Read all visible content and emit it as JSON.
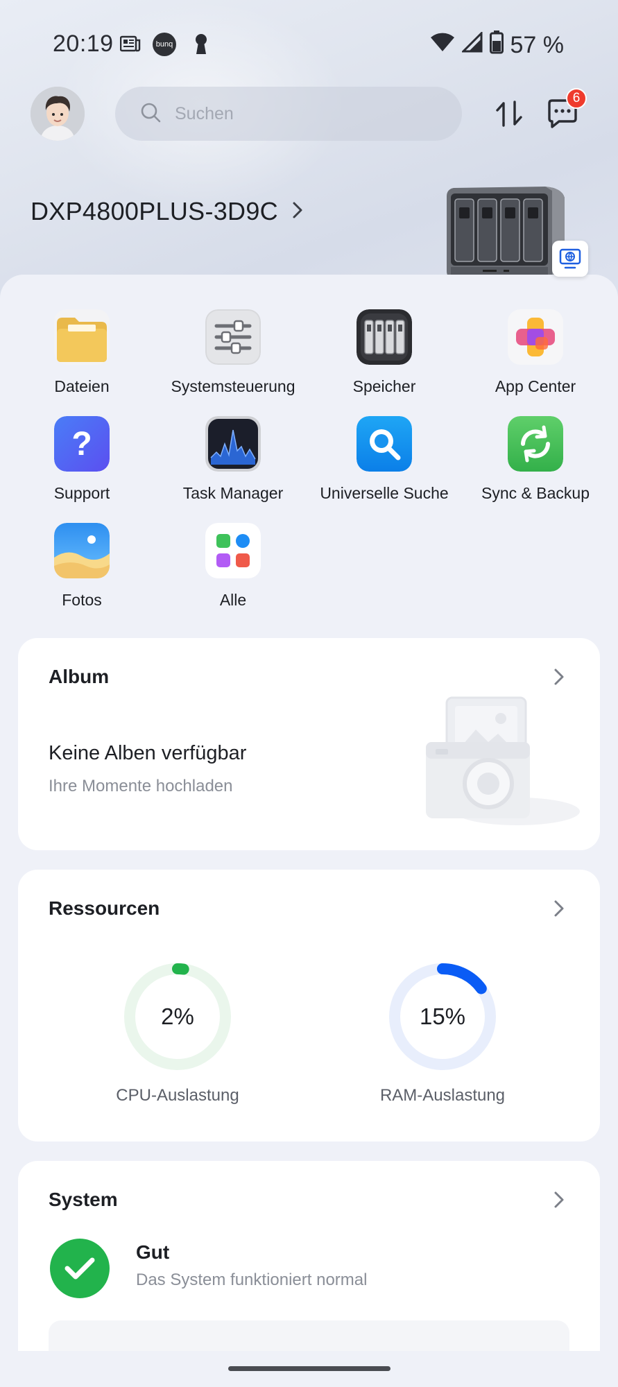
{
  "status_bar": {
    "time": "20:19",
    "bunq_label": "bunq",
    "battery": "57 %",
    "icons": [
      "news-icon",
      "bunq-icon",
      "keyhole-icon",
      "wifi-icon",
      "signal-icon",
      "battery-icon"
    ]
  },
  "header": {
    "search_placeholder": "Suchen",
    "notification_count": "6"
  },
  "device": {
    "name": "DXP4800PLUS-3D9C"
  },
  "apps": [
    {
      "label": "Dateien",
      "icon": "folder-icon"
    },
    {
      "label": "Systemsteuerung",
      "icon": "sliders-icon"
    },
    {
      "label": "Speicher",
      "icon": "drives-icon"
    },
    {
      "label": "App Center",
      "icon": "app-center-icon"
    },
    {
      "label": "Support",
      "icon": "question-icon"
    },
    {
      "label": "Task Manager",
      "icon": "activity-chart-icon"
    },
    {
      "label": "Universelle Suche",
      "icon": "magnifier-icon"
    },
    {
      "label": "Sync & Backup",
      "icon": "sync-icon"
    },
    {
      "label": "Fotos",
      "icon": "photos-icon"
    },
    {
      "label": "Alle",
      "icon": "all-apps-icon"
    }
  ],
  "album": {
    "title": "Album",
    "empty_title": "Keine Alben verfügbar",
    "empty_sub": "Ihre Momente hochladen"
  },
  "resources": {
    "title": "Ressourcen",
    "cpu": {
      "value": "2%",
      "fraction": 0.02,
      "label": "CPU-Auslastung",
      "color": "#22b34c",
      "track": "#eaf6ec"
    },
    "ram": {
      "value": "15%",
      "fraction": 0.15,
      "label": "RAM-Auslastung",
      "color": "#0a5cf5",
      "track": "#e8eefc"
    }
  },
  "system": {
    "title": "System",
    "state": "Gut",
    "description": "Das System funktioniert normal"
  },
  "colors": {
    "accent_blue": "#0a5cf5",
    "ok_green": "#22b34c",
    "badge_red": "#ef3b2d"
  }
}
